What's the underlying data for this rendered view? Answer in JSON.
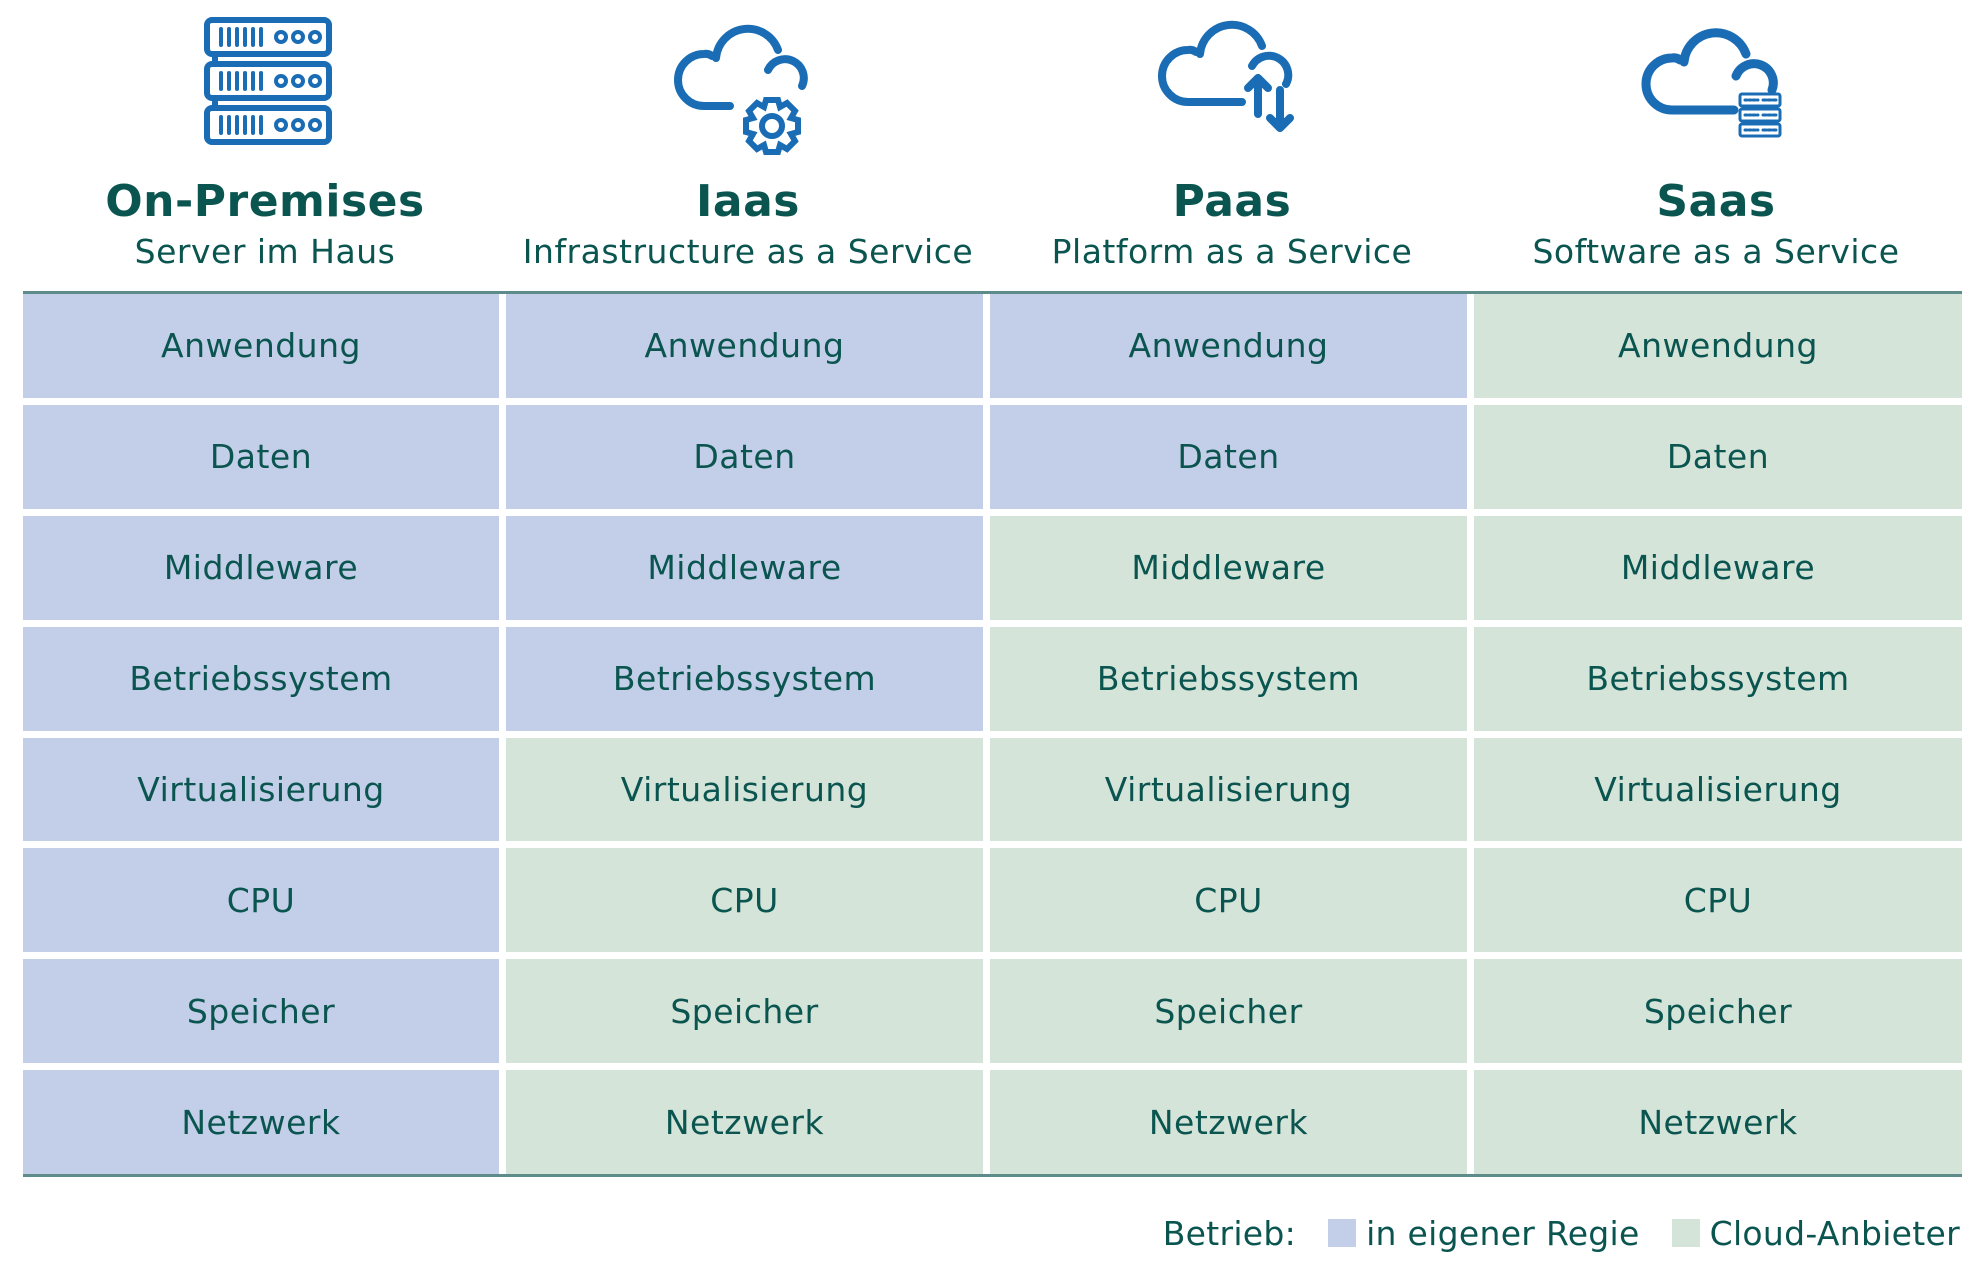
{
  "colors": {
    "own": "#c3cee9",
    "cloud": "#d5e4d9",
    "text": "#0b5550",
    "icon": "#1a6db5",
    "rule": "#5e8c8a"
  },
  "columns": [
    {
      "title": "On-Premises",
      "subtitle": "Server im Haus",
      "icon": "server-rack-icon"
    },
    {
      "title": "Iaas",
      "subtitle": "Infrastructure as a Service",
      "icon": "cloud-gear-icon"
    },
    {
      "title": "Paas",
      "subtitle": "Platform as a Service",
      "icon": "cloud-transfer-icon"
    },
    {
      "title": "Saas",
      "subtitle": "Software as a Service",
      "icon": "cloud-server-icon"
    }
  ],
  "layers": [
    "Anwendung",
    "Daten",
    "Middleware",
    "Betriebssystem",
    "Virtualisierung",
    "CPU",
    "Speicher",
    "Netzwerk"
  ],
  "operation": [
    [
      "own",
      "own",
      "own",
      "cloud"
    ],
    [
      "own",
      "own",
      "own",
      "cloud"
    ],
    [
      "own",
      "own",
      "cloud",
      "cloud"
    ],
    [
      "own",
      "own",
      "cloud",
      "cloud"
    ],
    [
      "own",
      "cloud",
      "cloud",
      "cloud"
    ],
    [
      "own",
      "cloud",
      "cloud",
      "cloud"
    ],
    [
      "own",
      "cloud",
      "cloud",
      "cloud"
    ],
    [
      "own",
      "cloud",
      "cloud",
      "cloud"
    ]
  ],
  "legend": {
    "label": "Betrieb:",
    "items": [
      {
        "key": "own",
        "label": "in eigener Regie"
      },
      {
        "key": "cloud",
        "label": "Cloud-Anbieter"
      }
    ]
  }
}
